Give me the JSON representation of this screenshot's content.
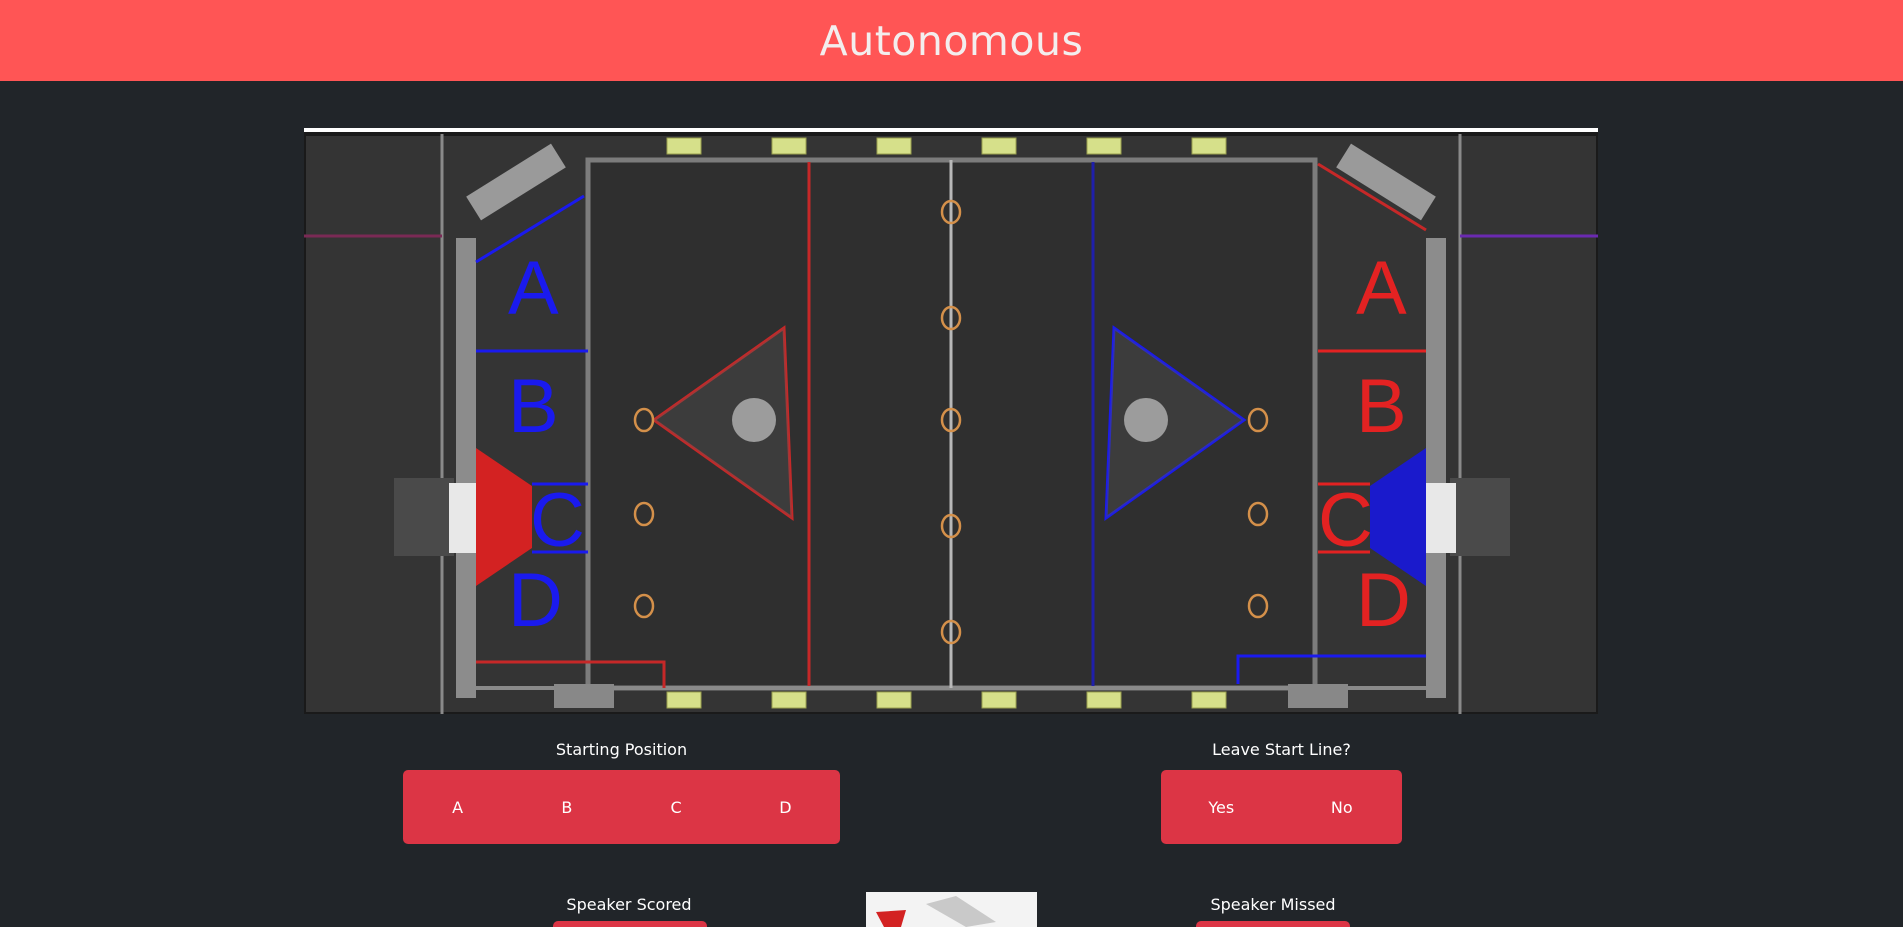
{
  "header": {
    "title": "Autonomous"
  },
  "colors": {
    "header_bg": "#ff5555",
    "button_bg": "#dc3545",
    "page_bg": "#212529",
    "red_alliance": "#e32222",
    "blue_alliance": "#1a1aee"
  },
  "field_map": {
    "blue_positions": [
      "A",
      "B",
      "C",
      "D"
    ],
    "red_positions": [
      "A",
      "B",
      "C",
      "D"
    ]
  },
  "starting_position": {
    "label": "Starting Position",
    "options": [
      "A",
      "B",
      "C",
      "D"
    ]
  },
  "leave_start_line": {
    "label": "Leave Start Line?",
    "options": [
      "Yes",
      "No"
    ]
  },
  "speaker_scored": {
    "label": "Speaker Scored"
  },
  "speaker_missed": {
    "label": "Speaker Missed"
  }
}
